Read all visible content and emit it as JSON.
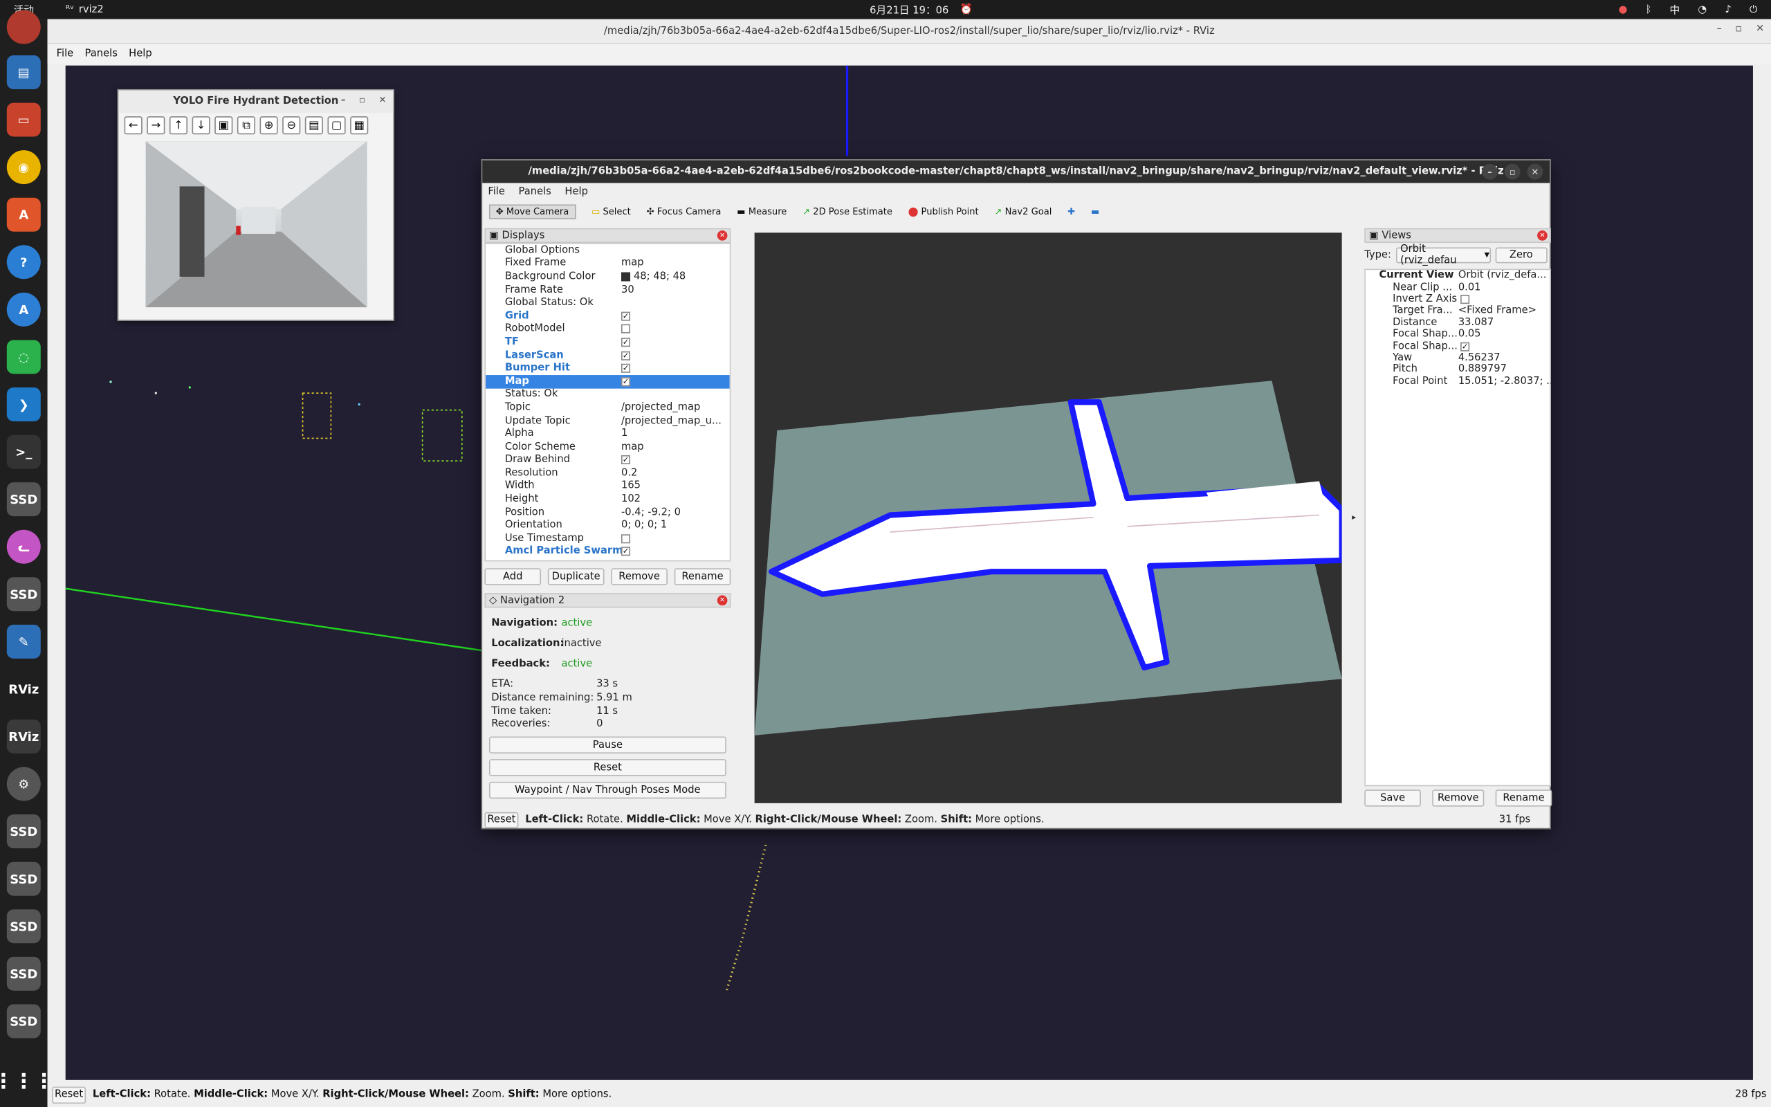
{
  "topbar": {
    "activities": "活动",
    "app": "rviz2",
    "clock": "6月21日 19：06",
    "ime": "中"
  },
  "main": {
    "title": "/media/zjh/76b3b05a-66a2-4ae4-a2eb-62df4a15dbe6/Super-LIO-ros2/install/super_lio/share/super_lio/rviz/lio.rviz* - RViz",
    "menu": {
      "file": "File",
      "panels": "Panels",
      "help": "Help"
    },
    "status": {
      "reset": "Reset",
      "b1": "Left-Click:",
      "t1": " Rotate. ",
      "b2": "Middle-Click:",
      "t2": " Move X/Y. ",
      "b3": "Right-Click/Mouse Wheel:",
      "t3": " Zoom. ",
      "b4": "Shift:",
      "t4": " More options."
    },
    "fps": "28 fps"
  },
  "yolo": {
    "title": "YOLO Fire Hydrant Detection"
  },
  "inner": {
    "title": "/media/zjh/76b3b05a-66a2-4ae4-a2eb-62df4a15dbe6/ros2bookcode-master/chapt8/chapt8_ws/install/nav2_bringup/share/nav2_bringup/rviz/nav2_default_view.rviz* - RViz",
    "menu": {
      "file": "File",
      "panels": "Panels",
      "help": "Help"
    },
    "tools": {
      "move": "Move Camera",
      "select": "Select",
      "focus": "Focus Camera",
      "measure": "Measure",
      "pose": "2D Pose Estimate",
      "point": "Publish Point",
      "goal": "Nav2 Goal"
    },
    "displays": {
      "header": "Displays",
      "rows": [
        {
          "k": "Global Options",
          "v": ""
        },
        {
          "k": "Fixed Frame",
          "v": "map"
        },
        {
          "k": "Background Color",
          "v": "48; 48; 48"
        },
        {
          "k": "Frame Rate",
          "v": "30"
        },
        {
          "k": "Global Status: Ok",
          "v": ""
        },
        {
          "k": "Grid",
          "v": ""
        },
        {
          "k": "RobotModel",
          "v": ""
        },
        {
          "k": "TF",
          "v": ""
        },
        {
          "k": "LaserScan",
          "v": ""
        },
        {
          "k": "Bumper Hit",
          "v": ""
        },
        {
          "k": "Map",
          "v": ""
        },
        {
          "k": "Status: Ok",
          "v": ""
        },
        {
          "k": "Topic",
          "v": "/projected_map"
        },
        {
          "k": "Update Topic",
          "v": "/projected_map_u..."
        },
        {
          "k": "Alpha",
          "v": "1"
        },
        {
          "k": "Color Scheme",
          "v": "map"
        },
        {
          "k": "Draw Behind",
          "v": ""
        },
        {
          "k": "Resolution",
          "v": "0.2"
        },
        {
          "k": "Width",
          "v": "165"
        },
        {
          "k": "Height",
          "v": "102"
        },
        {
          "k": "Position",
          "v": "-0.4; -9.2; 0"
        },
        {
          "k": "Orientation",
          "v": "0; 0; 0; 1"
        },
        {
          "k": "Use Timestamp",
          "v": ""
        },
        {
          "k": "Amcl Particle Swarm",
          "v": ""
        }
      ],
      "add": "Add",
      "duplicate": "Duplicate",
      "remove": "Remove",
      "rename": "Rename"
    },
    "nav2": {
      "header": "Navigation 2",
      "navigation_label": "Navigation:",
      "navigation": "active",
      "localization_label": "Localization:",
      "localization": "inactive",
      "feedback_label": "Feedback:",
      "feedback": "active",
      "eta_label": "ETA:",
      "eta": "33 s",
      "dist_label": "Distance remaining:",
      "dist": "5.91 m",
      "time_label": "Time taken:",
      "time": "11 s",
      "rec_label": "Recoveries:",
      "rec": "0",
      "pause": "Pause",
      "reset": "Reset",
      "waypoint": "Waypoint / Nav Through Poses Mode"
    },
    "views": {
      "header": "Views",
      "type_label": "Type:",
      "type": "Orbit (rviz_defau",
      "zero": "Zero",
      "rows": [
        {
          "k": "Current View",
          "v": "Orbit (rviz_defa..."
        },
        {
          "k": "Near Clip ...",
          "v": "0.01"
        },
        {
          "k": "Invert Z Axis",
          "v": ""
        },
        {
          "k": "Target Fra...",
          "v": "<Fixed Frame>"
        },
        {
          "k": "Distance",
          "v": "33.087"
        },
        {
          "k": "Focal Shap...",
          "v": "0.05"
        },
        {
          "k": "Focal Shap...",
          "v": ""
        },
        {
          "k": "Yaw",
          "v": "4.56237"
        },
        {
          "k": "Pitch",
          "v": "0.889797"
        },
        {
          "k": "Focal Point",
          "v": "15.051; -2.8037; ..."
        }
      ],
      "save": "Save",
      "remove": "Remove",
      "rename": "Rename"
    },
    "status": {
      "reset": "Reset",
      "b1": "Left-Click:",
      "t1": " Rotate. ",
      "b2": "Middle-Click:",
      "t2": " Move X/Y. ",
      "b3": "Right-Click/Mouse Wheel:",
      "t3": " Zoom. ",
      "b4": "Shift:",
      "t4": " More options."
    },
    "fps": "31 fps"
  }
}
